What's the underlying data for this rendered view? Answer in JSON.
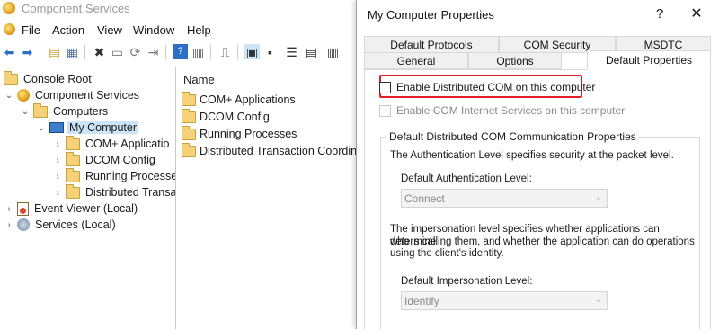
{
  "mmc": {
    "title": "Component Services",
    "menu": [
      "File",
      "Action",
      "View",
      "Window",
      "Help"
    ],
    "tree": [
      {
        "label": "Console Root"
      },
      {
        "label": "Component Services"
      },
      {
        "label": "Computers"
      },
      {
        "label": "My Computer"
      },
      {
        "label": "COM+ Applicatio"
      },
      {
        "label": "DCOM Config"
      },
      {
        "label": "Running Processe"
      },
      {
        "label": "Distributed Transa"
      },
      {
        "label": "Event Viewer (Local)"
      },
      {
        "label": "Services (Local)"
      }
    ],
    "list": {
      "column_name": "Name",
      "items": [
        "COM+ Applications",
        "DCOM Config",
        "Running Processes",
        "Distributed Transaction Coordin..."
      ]
    }
  },
  "dialog": {
    "title": "My Computer Properties",
    "help_glyph": "?",
    "close_glyph": "✕",
    "tabs_row1": [
      "Default Protocols",
      "COM Security",
      "MSDTC"
    ],
    "tabs_row2": [
      "General",
      "Options",
      "Default Properties"
    ],
    "active_tab": "Default Properties",
    "enable_dcom": {
      "label": "Enable Distributed COM on this computer",
      "checked": false
    },
    "enable_com_internet": {
      "label": "Enable COM Internet Services on this computer",
      "checked": false,
      "disabled": true
    },
    "group_title": "Default Distributed COM Communication Properties",
    "auth_desc": "The Authentication Level specifies security at the packet level.",
    "auth_label": "Default Authentication Level:",
    "auth_value": "Connect",
    "imp_desc_1": "The impersonation level specifies whether applications can determine",
    "imp_desc_2": "who is calling them, and whether the application can do operations",
    "imp_desc_3": "using the client's identity.",
    "imp_label": "Default Impersonation Level:",
    "imp_value": "Identify"
  },
  "colors": {
    "highlight_border": "#e02020",
    "selection": "#cce4f7"
  }
}
